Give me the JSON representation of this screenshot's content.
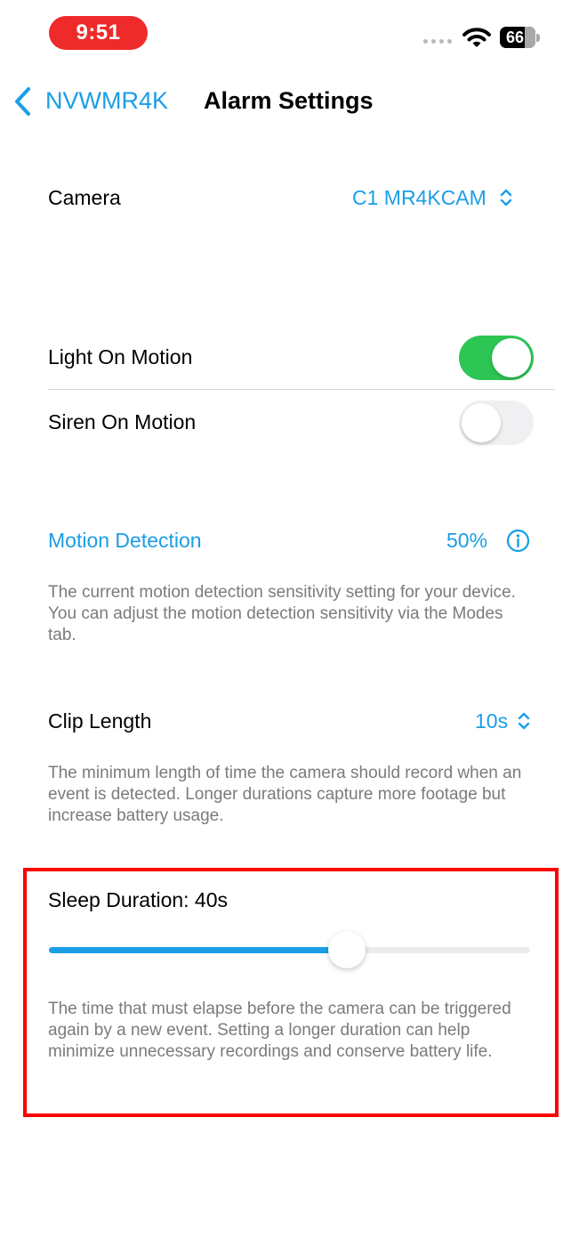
{
  "status_bar": {
    "time": "9:51",
    "battery": "66"
  },
  "nav": {
    "back_label": "NVWMR4K",
    "title": "Alarm Settings"
  },
  "camera": {
    "label": "Camera",
    "value": "C1 MR4KCAM"
  },
  "light_on_motion": {
    "label": "Light On Motion",
    "enabled": true
  },
  "siren_on_motion": {
    "label": "Siren On Motion",
    "enabled": false
  },
  "motion_detection": {
    "label": "Motion Detection",
    "value": "50%",
    "description": "The current motion detection sensitivity setting for your device. You can adjust the motion detection sensitivity via the Modes tab."
  },
  "clip_length": {
    "label": "Clip Length",
    "value": "10s",
    "description": "The minimum length of time the camera should record when an event is detected. Longer durations capture more footage but increase battery usage."
  },
  "sleep_duration": {
    "label": "Sleep Duration: 40s",
    "slider_fraction": 0.62,
    "description": "The time that must elapse before the camera can be triggered again by a new event. Setting a longer duration can help minimize unnecessary recordings and conserve battery life."
  },
  "colors": {
    "accent": "#1a9ee6",
    "toggle_on": "#2dc654",
    "highlight": "#ff0000",
    "time_pill": "#ee2a2a"
  }
}
